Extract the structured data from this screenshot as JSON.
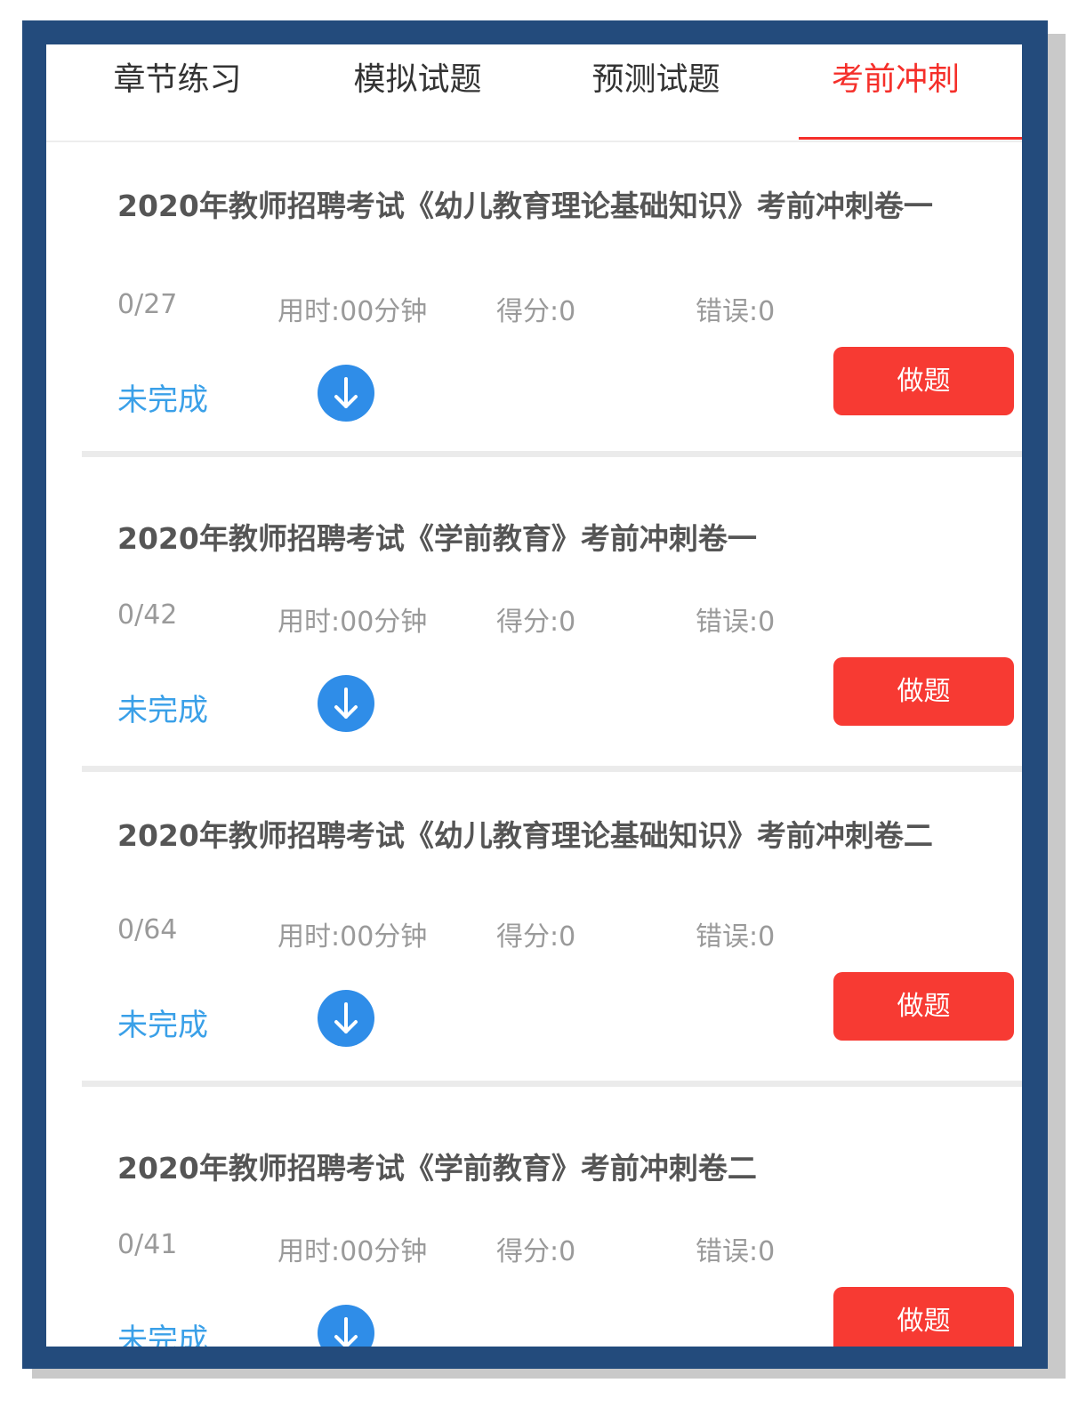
{
  "colors": {
    "frame": "#234b7c",
    "accent_red": "#f52f2a",
    "button_red": "#f73a33",
    "status_blue": "#3aa0e8",
    "download_blue": "#2f8de8",
    "title_gray": "#555555",
    "stat_gray": "#9a9a9a"
  },
  "tabs": [
    {
      "label": "章节练习",
      "active": false
    },
    {
      "label": "模拟试题",
      "active": false
    },
    {
      "label": "预测试题",
      "active": false
    },
    {
      "label": "考前冲刺",
      "active": true
    }
  ],
  "papers": [
    {
      "title": "2020年教师招聘考试《幼儿教育理论基础知识》考前冲刺卷一",
      "progress": "0/27",
      "time": "用时:00分钟",
      "score": "得分:0",
      "errors": "错误:0",
      "status": "未完成",
      "download_icon": "download-arrow-icon",
      "action": "做题"
    },
    {
      "title": "2020年教师招聘考试《学前教育》考前冲刺卷一",
      "progress": "0/42",
      "time": "用时:00分钟",
      "score": "得分:0",
      "errors": "错误:0",
      "status": "未完成",
      "download_icon": "download-arrow-icon",
      "action": "做题"
    },
    {
      "title": "2020年教师招聘考试《幼儿教育理论基础知识》考前冲刺卷二",
      "progress": "0/64",
      "time": "用时:00分钟",
      "score": "得分:0",
      "errors": "错误:0",
      "status": "未完成",
      "download_icon": "download-arrow-icon",
      "action": "做题"
    },
    {
      "title": "2020年教师招聘考试《学前教育》考前冲刺卷二",
      "progress": "0/41",
      "time": "用时:00分钟",
      "score": "得分:0",
      "errors": "错误:0",
      "status": "未完成",
      "download_icon": "download-arrow-icon",
      "action": "做题"
    }
  ]
}
